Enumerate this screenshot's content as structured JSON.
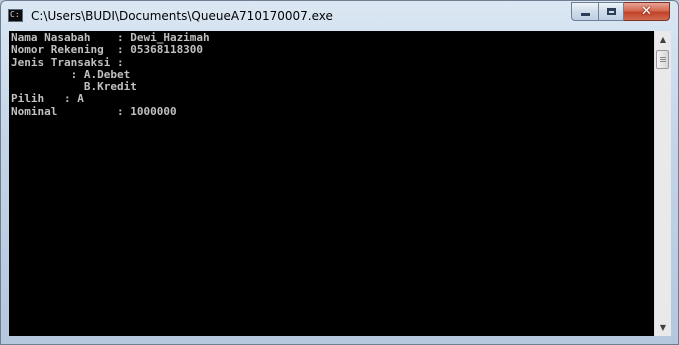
{
  "window": {
    "title": "C:\\Users\\BUDI\\Documents\\QueueA710170007.exe",
    "icon": "console-app-icon",
    "controls": {
      "minimize": "minimize-icon",
      "maximize": "maximize-icon",
      "close": "close-icon",
      "close_glyph": "✕"
    },
    "close_button_color": "#c84b32"
  },
  "console": {
    "background": "#000000",
    "foreground": "#c0c0c0",
    "lines": [
      "Nama Nasabah    : Dewi_Hazimah",
      "Nomor Rekening  : 05368118300",
      "Jenis Transaksi :",
      "         : A.Debet",
      "           B.Kredit",
      "Pilih   : A",
      "Nominal         : 1000000"
    ]
  },
  "scrollbar": {
    "up_glyph": "▲",
    "down_glyph": "▼"
  }
}
